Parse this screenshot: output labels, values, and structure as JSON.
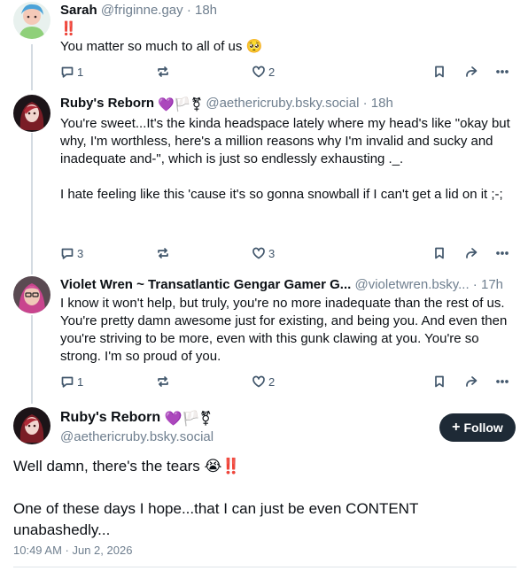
{
  "posts": [
    {
      "name": "Sarah",
      "handle": "@friginne.gay",
      "sep": " · ",
      "time": "18h",
      "line1": "‼️",
      "text": "You matter so much to all of us 🥺",
      "counts": {
        "reply": "1",
        "repost": "",
        "like": "2"
      }
    },
    {
      "name": "Ruby's Reborn",
      "badges": "💜🏳️⚧",
      "handle": "@aethericruby.bsky.social",
      "sep": " · ",
      "time": "18h",
      "text": "You're sweet...It's the kinda headspace lately where my head's like \"okay but why, I'm worthless, here's a million reasons why I'm invalid and sucky and inadequate and-\", which is just so endlessly exhausting ._.\n\nI hate feeling like this 'cause it's so gonna snowball if I can't get a lid on it ;-;",
      "counts": {
        "reply": "3",
        "repost": "",
        "like": "3"
      }
    },
    {
      "name": "Violet Wren ~ Transatlantic Gengar Gamer G...",
      "handle": "@violetwren.bsky...",
      "sep": " · ",
      "time": "17h",
      "text": "I know it won't help, but truly, you're no more inadequate than the rest of us. You're pretty damn awesome just for existing, and being you. And even then you're striving to be more, even with this gunk clawing at you. You're so strong. I'm so proud of you.",
      "counts": {
        "reply": "1",
        "repost": "",
        "like": "2"
      }
    }
  ],
  "main": {
    "name": "Ruby's Reborn",
    "badges": "💜🏳️⚧",
    "handle": "@aethericruby.bsky.social",
    "follow_label": "Follow",
    "text": "Well damn, there's the tears 😭‼️\n\nOne of these days I hope...that I can just be even CONTENT unabashedly...",
    "timestamp": "10:49 AM · Jun 2, 2026"
  },
  "colors": {
    "accent_dark": "#1e2a36",
    "muted": "#6f7f8f",
    "icon": "#42576c",
    "thread_line": "#d4dbe2"
  }
}
